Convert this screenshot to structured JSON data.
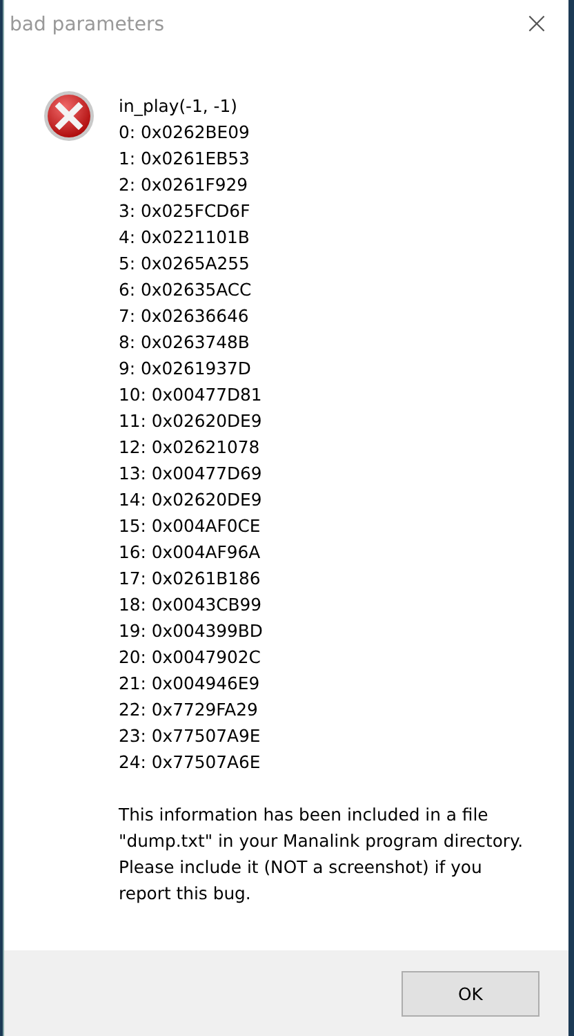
{
  "window": {
    "title": "bad parameters",
    "close": "×"
  },
  "message": {
    "kind": "error",
    "lines": [
      "in_play(-1, -1)",
      "0: 0x0262BE09",
      "1: 0x0261EB53",
      "2: 0x0261F929",
      "3: 0x025FCD6F",
      "4: 0x0221101B",
      "5: 0x0265A255",
      "6: 0x02635ACC",
      "7: 0x02636646",
      "8: 0x0263748B",
      "9: 0x0261937D",
      "10: 0x00477D81",
      "11: 0x02620DE9",
      "12: 0x02621078",
      "13: 0x00477D69",
      "14: 0x02620DE9",
      "15: 0x004AF0CE",
      "16: 0x004AF96A",
      "17: 0x0261B186",
      "18: 0x0043CB99",
      "19: 0x004399BD",
      "20: 0x0047902C",
      "21: 0x004946E9",
      "22: 0x7729FA29",
      "23: 0x77507A9E",
      "24: 0x77507A6E"
    ],
    "note": [
      "This information has been included in a file",
      "\"dump.txt\" in your Manalink program directory.",
      "Please include it (NOT a screenshot) if you",
      "report this bug."
    ]
  },
  "buttons": [
    "OK"
  ]
}
